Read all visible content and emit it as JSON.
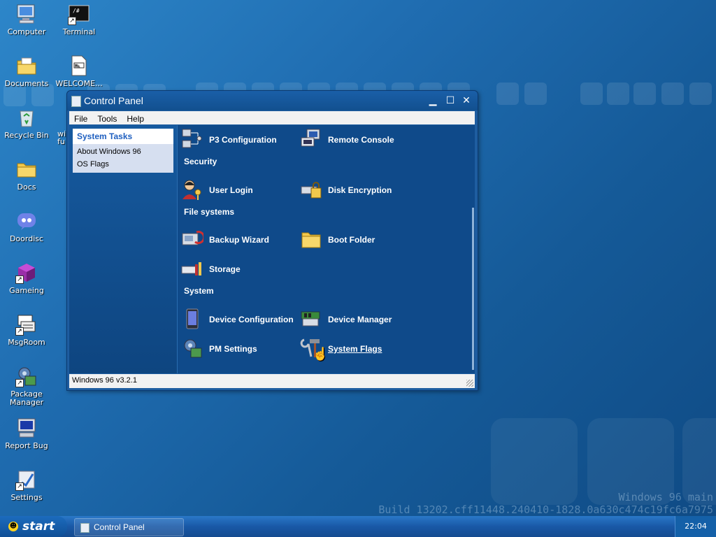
{
  "desktop": {
    "icons": [
      {
        "label": "Computer",
        "icon": "computer-icon"
      },
      {
        "label": "Terminal",
        "icon": "terminal-icon"
      },
      {
        "label": "Documents",
        "icon": "documents-icon"
      },
      {
        "label": "WELCOME...",
        "icon": "file-icon"
      },
      {
        "label": "Recycle Bin",
        "icon": "recycle-bin-icon"
      },
      {
        "label": "wi\nfu",
        "icon": "partial-icon"
      },
      {
        "label": "Docs",
        "icon": "folder-icon"
      },
      {
        "label": "Doordisc",
        "icon": "doordisc-icon"
      },
      {
        "label": "Gameing",
        "icon": "cube-icon"
      },
      {
        "label": "MsgRoom",
        "icon": "msgroom-icon"
      },
      {
        "label": "Package Manager",
        "icon": "package-manager-icon"
      },
      {
        "label": "Report Bug",
        "icon": "report-bug-icon"
      },
      {
        "label": "Settings",
        "icon": "settings-icon"
      }
    ],
    "watermark_line1": "Windows 96 main",
    "watermark_line2": "Build 13202.cff11448.240410-1828.0a630c474c19fc6a7975"
  },
  "window": {
    "title": "Control Panel",
    "menu": [
      "File",
      "Tools",
      "Help"
    ],
    "sidebar": {
      "header": "System Tasks",
      "links": [
        "About Windows 96",
        "OS Flags"
      ]
    },
    "sections": [
      {
        "title": "Security"
      },
      {
        "title": "File systems"
      },
      {
        "title": "System"
      }
    ],
    "items": [
      {
        "label": "P3 Configuration",
        "icon": "network-icon"
      },
      {
        "label": "Remote Console",
        "icon": "remote-console-icon"
      },
      {
        "label": "User Login",
        "icon": "user-key-icon"
      },
      {
        "label": "Disk Encryption",
        "icon": "disk-lock-icon"
      },
      {
        "label": "Backup Wizard",
        "icon": "backup-icon"
      },
      {
        "label": "Boot Folder",
        "icon": "folder-icon"
      },
      {
        "label": "Storage",
        "icon": "storage-icon"
      },
      {
        "label": "Device Configuration",
        "icon": "device-icon"
      },
      {
        "label": "Device Manager",
        "icon": "device-manager-icon"
      },
      {
        "label": "PM Settings",
        "icon": "pm-settings-icon"
      },
      {
        "label": "System Flags",
        "icon": "wrench-hammer-icon"
      }
    ],
    "status": "Windows 96 v3.2.1"
  },
  "taskbar": {
    "start_label": "start",
    "task_label": "Control Panel",
    "clock": "22:04"
  }
}
